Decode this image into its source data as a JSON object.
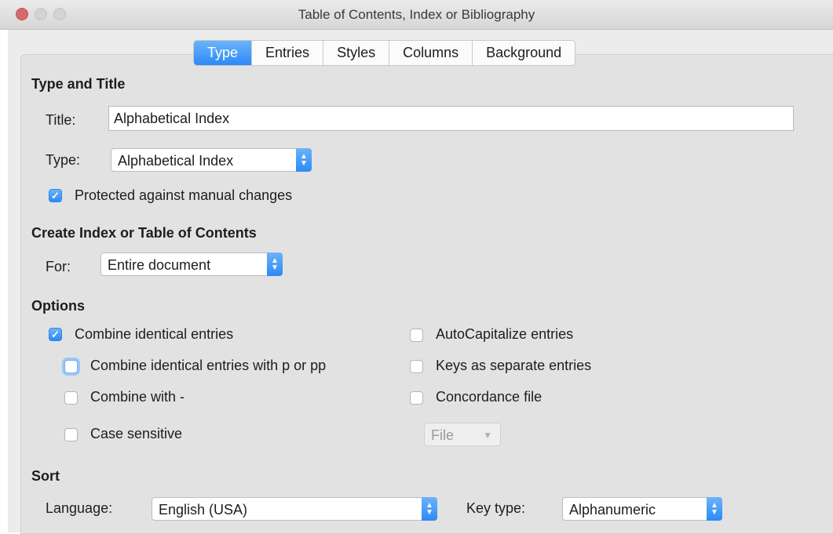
{
  "window": {
    "title": "Table of Contents, Index or Bibliography"
  },
  "tabs": [
    {
      "label": "Type"
    },
    {
      "label": "Entries"
    },
    {
      "label": "Styles"
    },
    {
      "label": "Columns"
    },
    {
      "label": "Background"
    }
  ],
  "type_and_title": {
    "heading": "Type and Title",
    "title_label": "Title:",
    "title_value": "Alphabetical Index",
    "type_label": "Type:",
    "type_value": "Alphabetical Index",
    "protected_label": "Protected against manual changes",
    "protected_checked": true
  },
  "create": {
    "heading": "Create Index or Table of Contents",
    "for_label": "For:",
    "for_value": "Entire document"
  },
  "options": {
    "heading": "Options",
    "combine_identical": {
      "label": "Combine identical entries",
      "checked": true
    },
    "combine_p_pp": {
      "label": "Combine identical entries with p or pp",
      "checked": false
    },
    "combine_with": {
      "label": "Combine with -",
      "checked": false
    },
    "case_sensitive": {
      "label": "Case sensitive",
      "checked": false
    },
    "autocapitalize": {
      "label": "AutoCapitalize entries",
      "checked": false
    },
    "keys_separate": {
      "label": "Keys as separate entries",
      "checked": false
    },
    "concordance": {
      "label": "Concordance file",
      "checked": false
    },
    "file_button": "File"
  },
  "sort": {
    "heading": "Sort",
    "language_label": "Language:",
    "language_value": "English (USA)",
    "key_type_label": "Key type:",
    "key_type_value": "Alphanumeric"
  },
  "colors": {
    "accent": "#2c8af5",
    "panel": "#e2e2e2"
  }
}
